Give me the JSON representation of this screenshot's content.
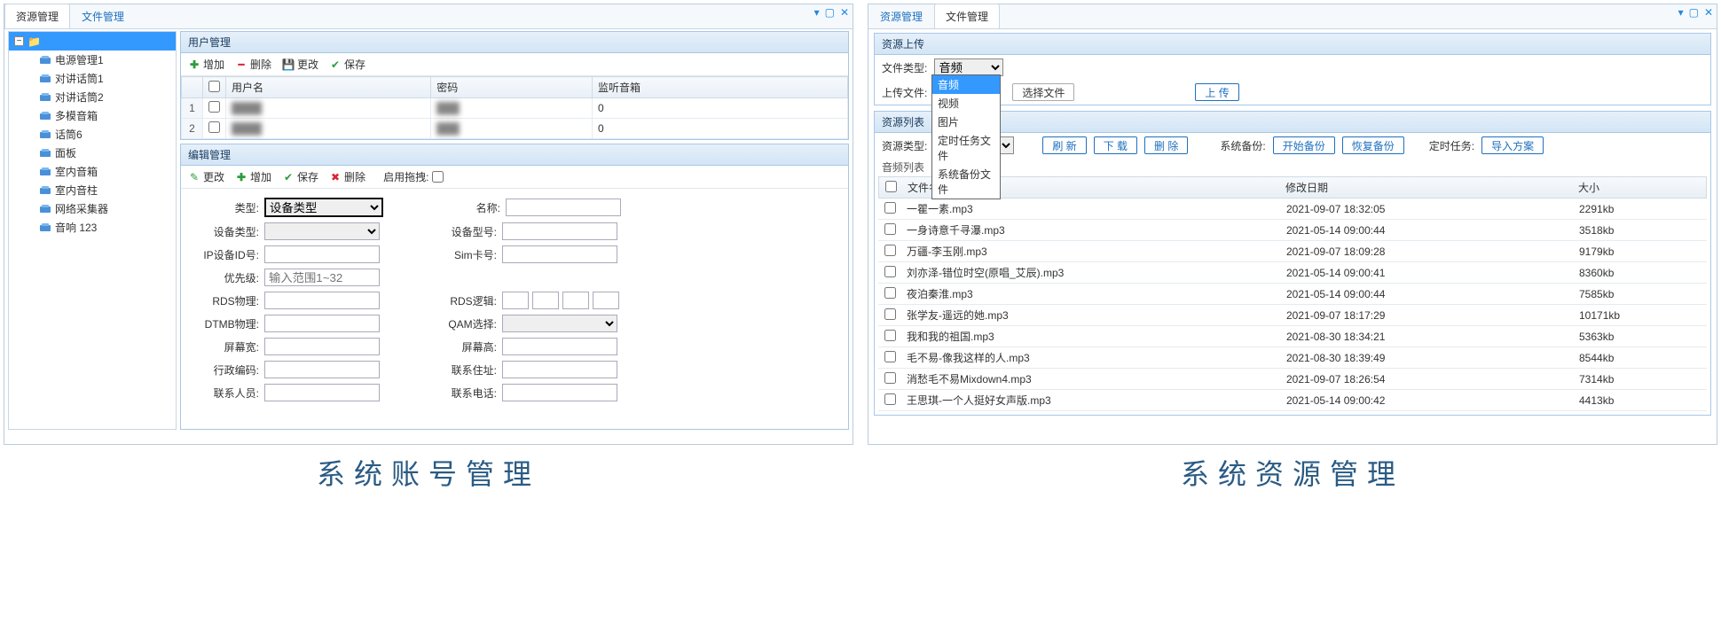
{
  "captions": {
    "left": "系统账号管理",
    "right": "系统资源管理"
  },
  "left": {
    "tabs": [
      {
        "label": "资源管理",
        "active": true
      },
      {
        "label": "文件管理",
        "active": false
      }
    ],
    "tree": {
      "root_label": "",
      "items": [
        "电源管理1",
        "对讲话筒1",
        "对讲话筒2",
        "多模音箱",
        "话筒6",
        "面板",
        "室内音箱",
        "室内音柱",
        "网络采集器",
        "音响 123"
      ]
    },
    "user_panel": {
      "title": "用户管理",
      "toolbar": {
        "add": "增加",
        "del": "删除",
        "edit": "更改",
        "save": "保存"
      },
      "headers": {
        "check": "",
        "username": "用户名",
        "password": "密码",
        "listen": "监听音箱"
      },
      "rows": [
        {
          "num": "1",
          "username": "",
          "password": "",
          "listen": "0"
        },
        {
          "num": "2",
          "username": "",
          "password": "",
          "listen": "0"
        }
      ]
    },
    "edit_panel": {
      "title": "编辑管理",
      "toolbar": {
        "edit": "更改",
        "add": "增加",
        "save": "保存",
        "del": "删除",
        "drag": "启用拖拽:"
      },
      "fields": {
        "type_lab": "类型:",
        "type_opt": "设备类型",
        "name_lab": "名称:",
        "devtype_lab": "设备类型:",
        "devmodel_lab": "设备型号:",
        "ipid_lab": "IP设备ID号:",
        "sim_lab": "Sim卡号:",
        "priority_lab": "优先级:",
        "priority_ph": "输入范围1~32",
        "rds_phy_lab": "RDS物理:",
        "rds_log_lab": "RDS逻辑:",
        "dtmb_lab": "DTMB物理:",
        "qam_lab": "QAM选择:",
        "scr_w_lab": "屏幕宽:",
        "scr_h_lab": "屏幕高:",
        "admin_code_lab": "行政编码:",
        "addr_lab": "联系住址:",
        "contact_lab": "联系人员:",
        "phone_lab": "联系电话:"
      }
    }
  },
  "right": {
    "tabs": [
      {
        "label": "资源管理",
        "active": false
      },
      {
        "label": "文件管理",
        "active": true
      }
    ],
    "upload": {
      "title": "资源上传",
      "filetype_lab": "文件类型:",
      "filetype_value": "音频",
      "dropdown": [
        "音频",
        "视频",
        "图片",
        "定时任务文件",
        "系统备份文件"
      ],
      "uploadfile_lab": "上传文件:",
      "choose_btn": "选择文件",
      "upload_btn": "上 传"
    },
    "listpanel": {
      "title": "资源列表",
      "restype_lab": "资源类型:",
      "restype_value": "音频列表",
      "refresh": "刷 新",
      "download": "下 载",
      "delete": "删 除",
      "backup_lab": "系统备份:",
      "start_backup": "开始备份",
      "restore_backup": "恢复备份",
      "task_lab": "定时任务:",
      "import": "导入方案",
      "list_title": "音频列表",
      "headers": {
        "name": "文件名称",
        "date": "修改日期",
        "size": "大小"
      },
      "rows": [
        {
          "name": "一瞿一素.mp3",
          "date": "2021-09-07 18:32:05",
          "size": "2291kb"
        },
        {
          "name": "一身诗意千寻瀑.mp3",
          "date": "2021-05-14 09:00:44",
          "size": "3518kb"
        },
        {
          "name": "万疆-李玉刚.mp3",
          "date": "2021-09-07 18:09:28",
          "size": "9179kb"
        },
        {
          "name": "刘亦泽-错位时空(原唱_艾辰).mp3",
          "date": "2021-05-14 09:00:41",
          "size": "8360kb"
        },
        {
          "name": "夜泊秦淮.mp3",
          "date": "2021-05-14 09:00:44",
          "size": "7585kb"
        },
        {
          "name": "张学友-遥远的她.mp3",
          "date": "2021-09-07 18:17:29",
          "size": "10171kb"
        },
        {
          "name": "我和我的祖国.mp3",
          "date": "2021-08-30 18:34:21",
          "size": "5363kb"
        },
        {
          "name": "毛不易-像我这样的人.mp3",
          "date": "2021-08-30 18:39:49",
          "size": "8544kb"
        },
        {
          "name": "消愁毛不易Mixdown4.mp3",
          "date": "2021-09-07 18:26:54",
          "size": "7314kb"
        },
        {
          "name": "王思琪-一个人挺好女声版.mp3",
          "date": "2021-05-14 09:00:42",
          "size": "4413kb"
        }
      ]
    }
  }
}
